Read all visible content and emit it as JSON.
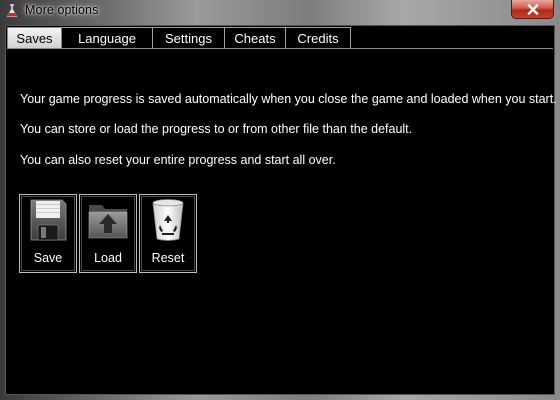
{
  "window": {
    "title": "More options",
    "icon": "app-icon",
    "close_icon": "close-icon"
  },
  "tabs": [
    {
      "label": "Saves",
      "active": true
    },
    {
      "label": "Language",
      "active": false
    },
    {
      "label": "Settings",
      "active": false
    },
    {
      "label": "Cheats",
      "active": false
    },
    {
      "label": "Credits",
      "active": false
    }
  ],
  "saves_panel": {
    "paragraphs": [
      "Your game progress is saved automatically when you close the game and loaded when you start.",
      "You can store or load the progress to or from other file than the default.",
      "You can also reset your entire progress and start all over."
    ],
    "buttons": [
      {
        "label": "Save",
        "icon": "floppy-disk-icon"
      },
      {
        "label": "Load",
        "icon": "folder-upload-icon"
      },
      {
        "label": "Reset",
        "icon": "recycle-bin-icon"
      }
    ]
  },
  "colors": {
    "background": "#000000",
    "text": "#ffffff",
    "close_button": "#c7402c"
  }
}
